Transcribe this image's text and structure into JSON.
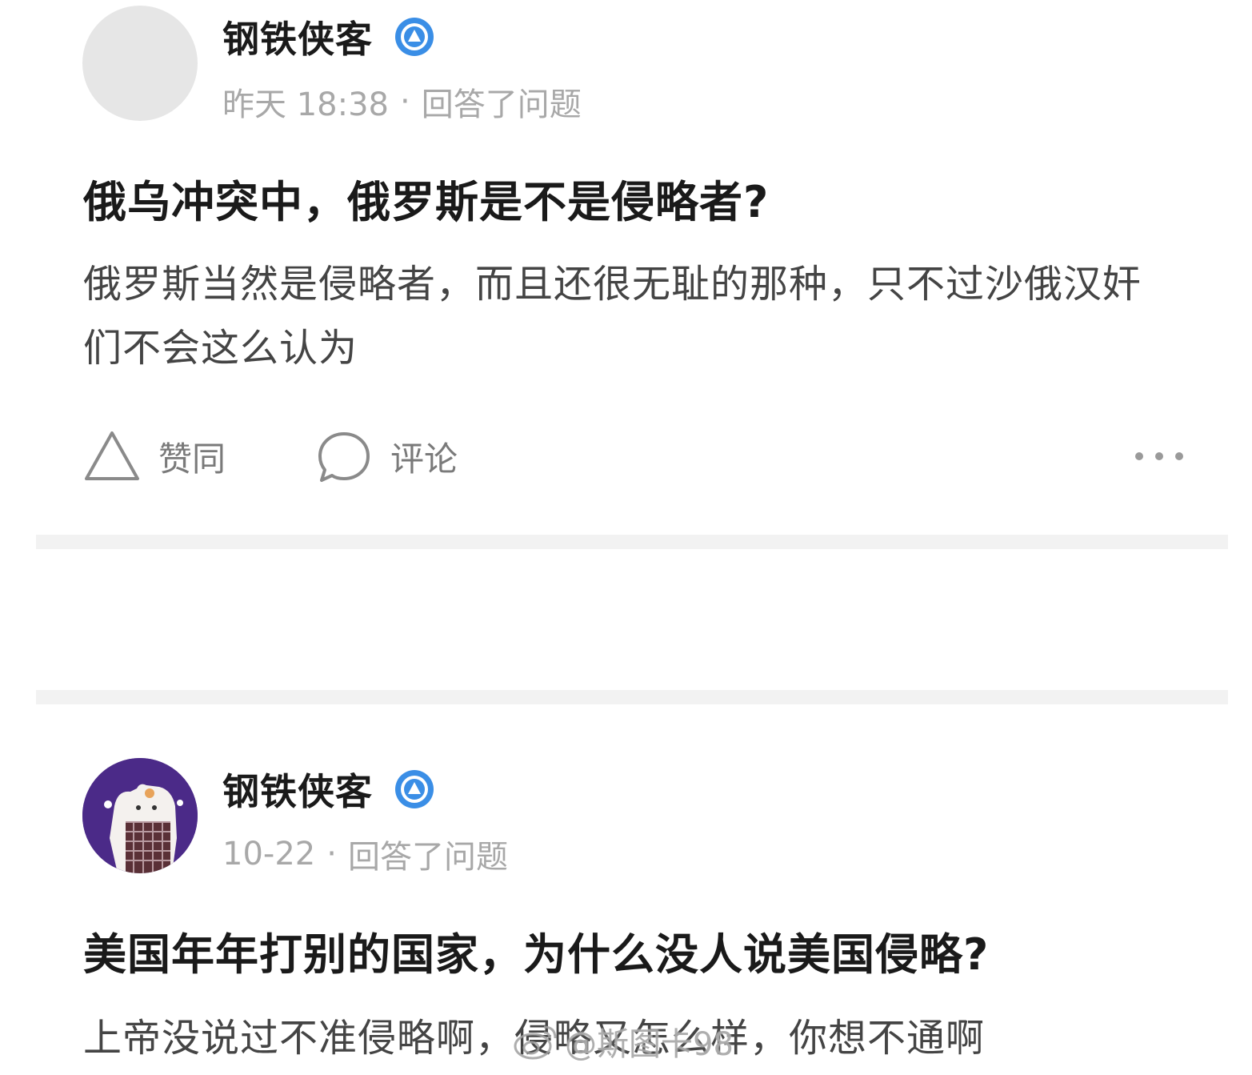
{
  "posts": [
    {
      "author": "钢铁侠客",
      "time": "昨天 18:38",
      "separator": "·",
      "action": "回答了问题",
      "question": "俄乌冲突中，俄罗斯是不是侵略者?",
      "answer": "俄罗斯当然是侵略者，而且还很无耻的那种，只不过沙俄汉奸们不会这么认为",
      "upvote_label": "赞同",
      "comment_label": "评论"
    },
    {
      "author": "钢铁侠客",
      "time": "10-22",
      "separator": "·",
      "action": "回答了问题",
      "question": "美国年年打别的国家，为什么没人说美国侵略?",
      "answer": "上帝没说过不准侵略啊，侵略又怎么样，你想不通啊"
    }
  ],
  "watermark": "@斯图卡98",
  "colors": {
    "verified_badge": "#3a8ee6",
    "avatar_placeholder": "#e6e6e6",
    "avatar_purple": "#4b2a88",
    "separator": "#f2f2f2",
    "meta_text": "#a8a8a8"
  },
  "icons": {
    "verified": "verified-badge-icon",
    "upvote": "triangle-upvote-icon",
    "comment": "speech-bubble-icon",
    "more": "ellipsis-icon",
    "watermark": "weibo-logo-icon"
  }
}
